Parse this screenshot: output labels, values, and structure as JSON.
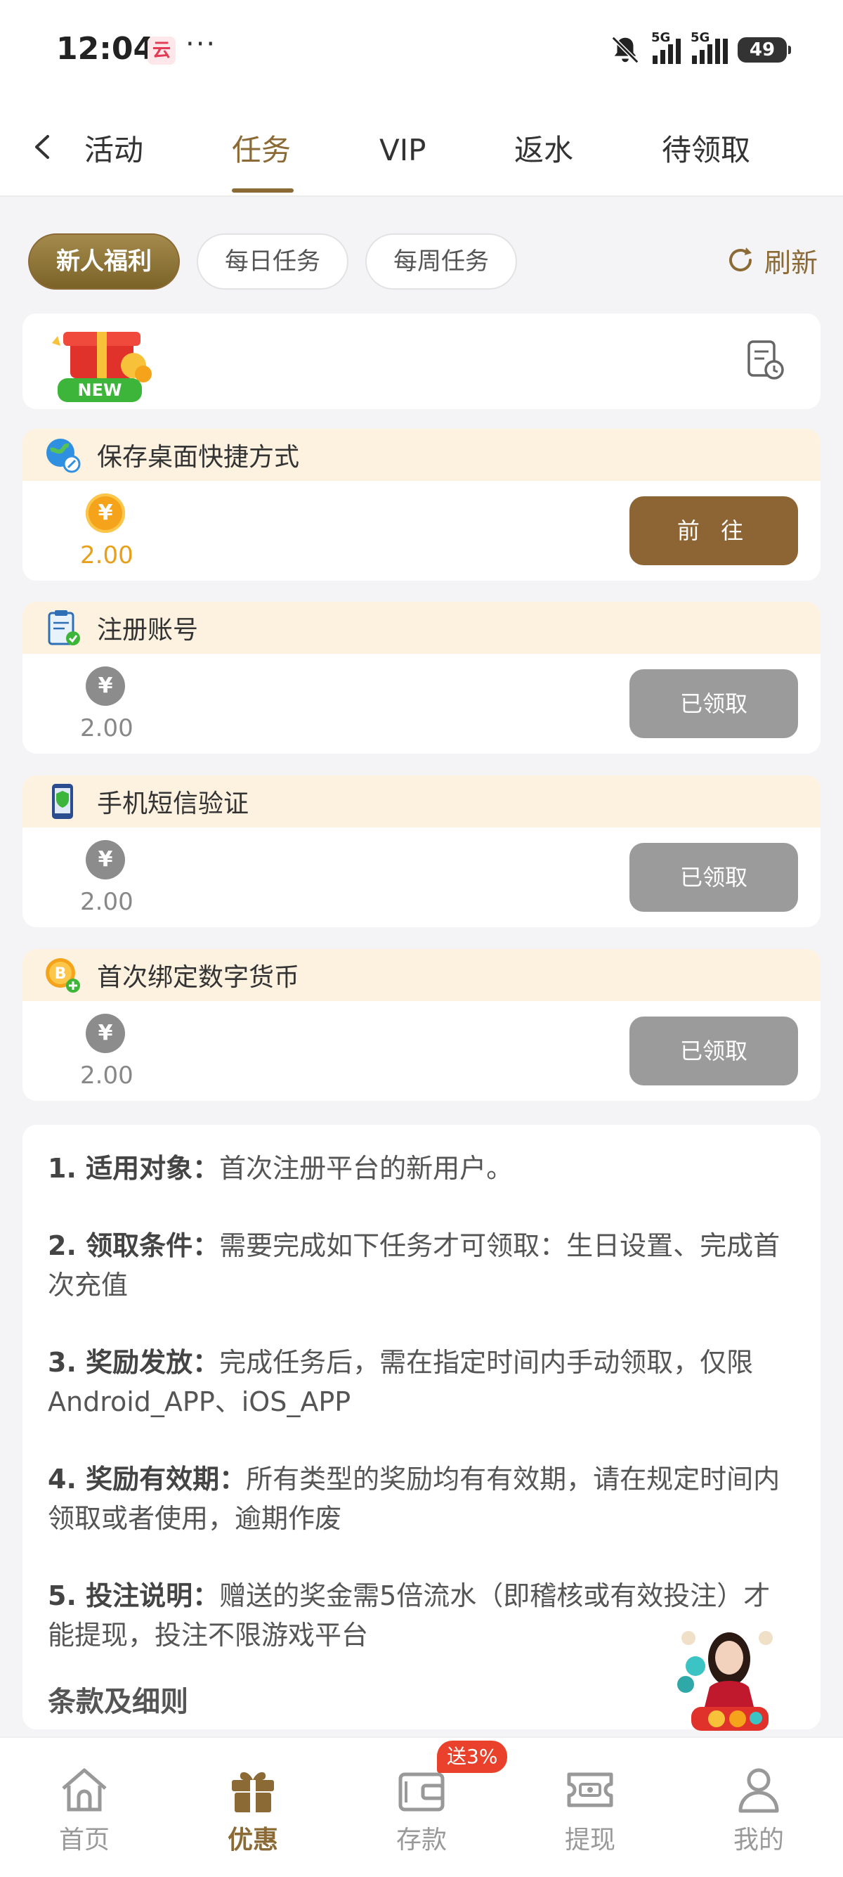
{
  "status_bar": {
    "time": "12:04",
    "app_icon_text": "云",
    "more": "···",
    "network1": "5G",
    "network2": "5G",
    "battery": "49"
  },
  "tabs": {
    "items": [
      {
        "label": "活动"
      },
      {
        "label": "任务"
      },
      {
        "label": "VIP"
      },
      {
        "label": "返水"
      },
      {
        "label": "待领取"
      }
    ],
    "active_index": 1
  },
  "filters": {
    "chips": [
      {
        "label": "新人福利"
      },
      {
        "label": "每日任务"
      },
      {
        "label": "每周任务"
      }
    ],
    "active_index": 0,
    "refresh_label": "刷新"
  },
  "banner": {
    "badge_text": "NEW"
  },
  "tasks": [
    {
      "title": "保存桌面快捷方式",
      "coin": "¥",
      "amount": "2.00",
      "button": "前 往",
      "state": "go",
      "icon": "globe-link-icon"
    },
    {
      "title": "注册账号",
      "coin": "¥",
      "amount": "2.00",
      "button": "已领取",
      "state": "claimed",
      "icon": "clipboard-check-icon"
    },
    {
      "title": "手机短信验证",
      "coin": "¥",
      "amount": "2.00",
      "button": "已领取",
      "state": "claimed",
      "icon": "phone-shield-icon"
    },
    {
      "title": "首次绑定数字货币",
      "coin": "¥",
      "amount": "2.00",
      "button": "已领取",
      "state": "claimed",
      "icon": "bitcoin-add-icon"
    }
  ],
  "rules": [
    {
      "label": "1. 适用对象：",
      "text": "首次注册平台的新用户。"
    },
    {
      "label": "2. 领取条件：",
      "text": "需要完成如下任务才可领取：生日设置、完成首次充值"
    },
    {
      "label": "3. 奖励发放：",
      "text": "完成任务后，需在指定时间内手动领取，仅限Android_APP、iOS_APP"
    },
    {
      "label": "4. 奖励有效期：",
      "text": "所有类型的奖励均有有效期，请在规定时间内领取或者使用，逾期作废"
    },
    {
      "label": "5. 投注说明：",
      "text": "赠送的奖金需5倍流水（即稽核或有效投注）才能提现，投注不限游戏平台"
    }
  ],
  "terms_title": "条款及细则",
  "bottom_nav": {
    "items": [
      {
        "label": "首页",
        "icon": "home-icon"
      },
      {
        "label": "优惠",
        "icon": "gift-icon"
      },
      {
        "label": "存款",
        "icon": "wallet-icon"
      },
      {
        "label": "提现",
        "icon": "ticket-icon"
      },
      {
        "label": "我的",
        "icon": "user-icon"
      }
    ],
    "active_index": 1,
    "promo_badge": "送3%"
  },
  "colors": {
    "accent": "#8b6a35",
    "claimed": "#9b9b9b",
    "coin_gold": "#f5a31a",
    "task_header_bg": "#fdf1e0",
    "promo_red": "#e9412b"
  }
}
